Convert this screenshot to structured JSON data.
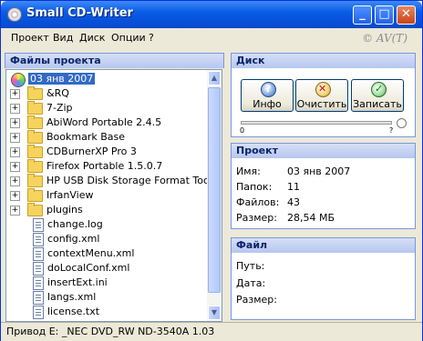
{
  "window": {
    "title": "Small CD-Writer",
    "credit": "© AV(T)"
  },
  "menu": [
    "Проект",
    "Вид",
    "Диск",
    "Опции",
    "?"
  ],
  "project_files": {
    "header": "Файлы проекта",
    "root_label": "03 янв 2007",
    "folders": [
      "&RQ",
      "7-Zip",
      "AbiWord Portable 2.4.5",
      "Bookmark Base",
      "CDBurnerXP Pro 3",
      "Firefox Portable 1.5.0.7",
      "HP USB Disk Storage Format Tool",
      "IrfanView",
      "plugins"
    ],
    "files": [
      "change.log",
      "config.xml",
      "contextMenu.xml",
      "doLocalConf.xml",
      "insertExt.ini",
      "langs.xml",
      "license.txt"
    ]
  },
  "disk": {
    "header": "Диск",
    "buttons": {
      "info": "Инфо",
      "clear": "Очистить",
      "write": "Записать"
    },
    "slider_min": "0",
    "slider_max": "?"
  },
  "project": {
    "header": "Проект",
    "name_label": "Имя:",
    "name_value": "03 янв 2007",
    "folders_label": "Папок:",
    "folders_value": "11",
    "files_label": "Файлов:",
    "files_value": "43",
    "size_label": "Размер:",
    "size_value": "28,54 МБ"
  },
  "file_panel": {
    "header": "Файл",
    "path_label": "Путь:",
    "date_label": "Дата:",
    "size_label": "Размер:"
  },
  "statusbar": {
    "text": "Привод  E:  _NEC DVD_RW ND-3540A 1.03"
  }
}
